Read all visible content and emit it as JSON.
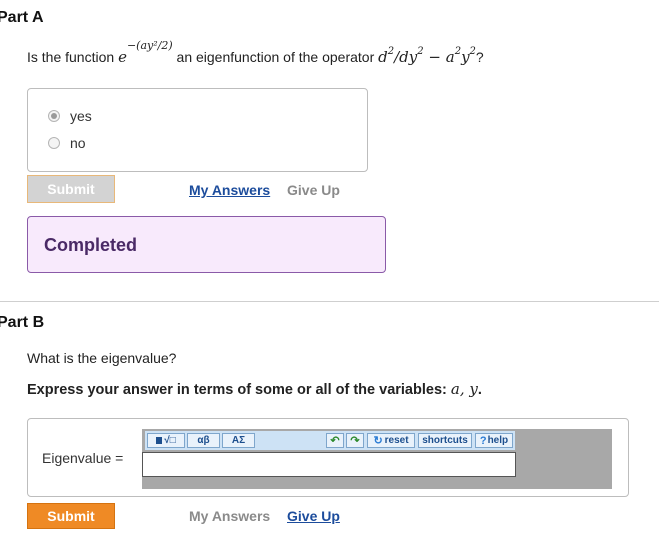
{
  "partA": {
    "title": "Part A",
    "question_before": "Is the function",
    "func_base": "e",
    "func_exponent": "−(ay²/2)",
    "question_middle": "an eigenfunction of the operator",
    "operator_d2": "d",
    "operator_slash": "/dy",
    "operator_minus": " − a",
    "operator_y": "y",
    "sup2": "2",
    "question_end": "?",
    "choices": [
      {
        "label": "yes",
        "selected": true
      },
      {
        "label": "no",
        "selected": false
      }
    ],
    "submit_label": "Submit",
    "my_answers_label": "My Answers",
    "give_up_label": "Give Up",
    "completed_label": "Completed"
  },
  "partB": {
    "title": "Part B",
    "question": "What is the eigenvalue?",
    "instruction_prefix": "Express your answer in terms of some or all of the variables: ",
    "instruction_vars": "a, y",
    "instruction_end": ".",
    "answer_label": "Eigenvalue =",
    "answer_value": "",
    "toolbar": {
      "templates_label": "√□",
      "greek_label": "αβ",
      "symbols_label": "ΑΣ",
      "reset_label": "reset",
      "shortcuts_label": "shortcuts",
      "help_label": "help"
    },
    "submit_label": "Submit",
    "my_answers_label": "My Answers",
    "give_up_label": "Give Up"
  }
}
